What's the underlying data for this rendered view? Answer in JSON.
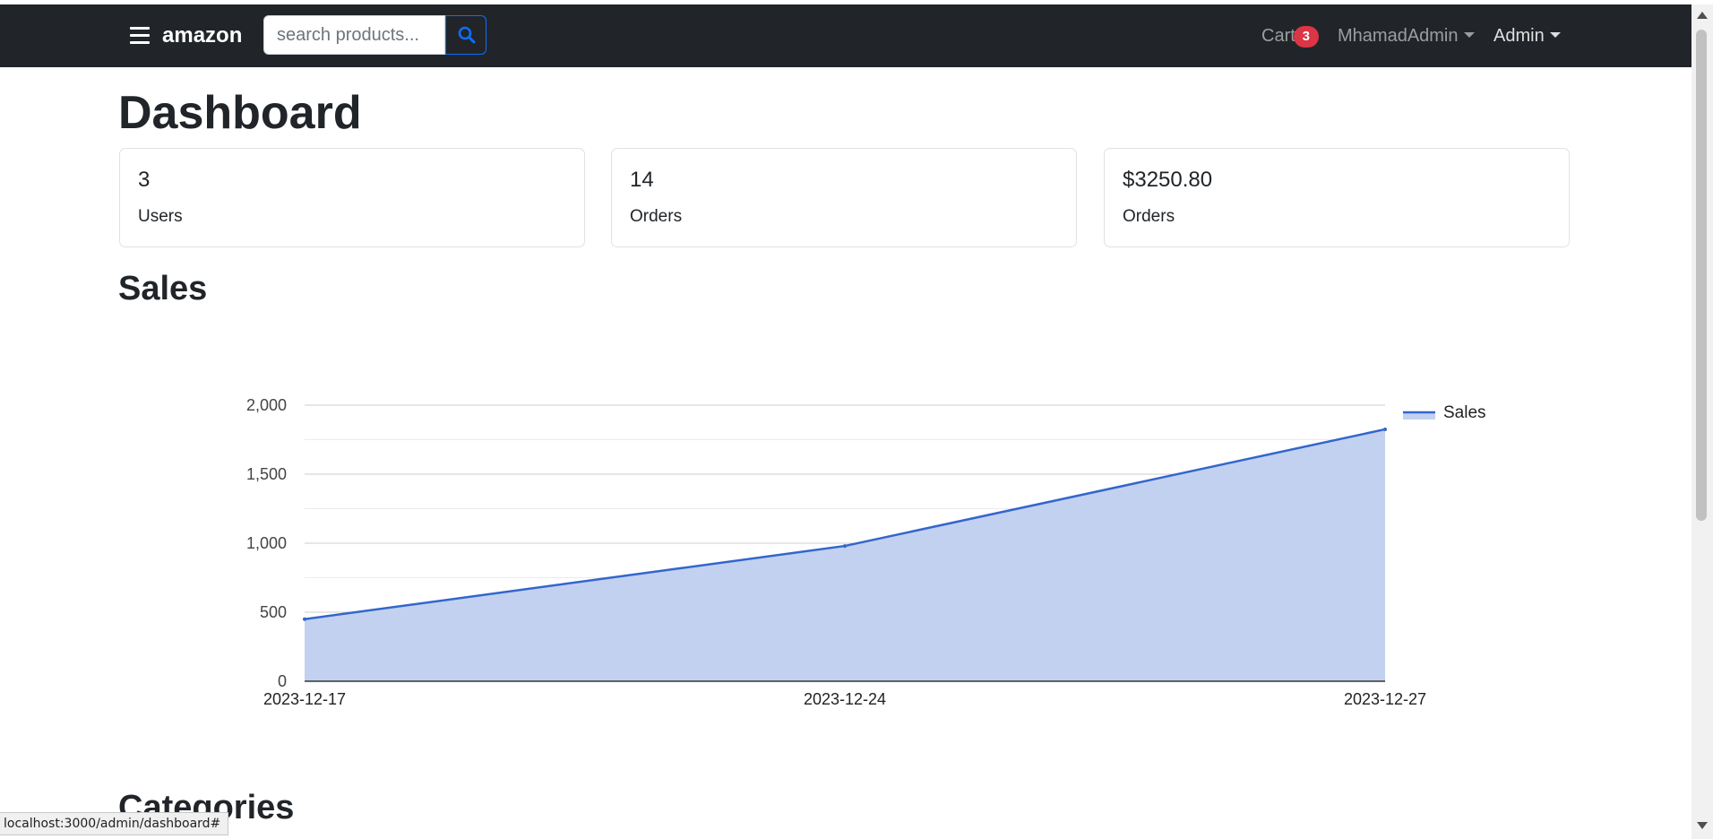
{
  "navbar": {
    "brand": "amazon",
    "search_placeholder": "search products...",
    "cart_label": "Cart",
    "cart_count": "3",
    "user_menu_label": "MhamadAdmin",
    "admin_menu_label": "Admin"
  },
  "page": {
    "title": "Dashboard",
    "sales_heading": "Sales",
    "categories_heading": "Categories"
  },
  "stats": [
    {
      "value": "3",
      "label": "Users"
    },
    {
      "value": "14",
      "label": "Orders"
    },
    {
      "value": "$3250.80",
      "label": "Orders"
    }
  ],
  "chart_data": {
    "type": "area",
    "x": [
      "2023-12-17",
      "2023-12-24",
      "2023-12-27"
    ],
    "series": [
      {
        "name": "Sales",
        "values": [
          450,
          980,
          1825
        ]
      }
    ],
    "yticks": [
      "0",
      "500",
      "1,000",
      "1,500",
      "2,000"
    ],
    "ylim": [
      0,
      2000
    ],
    "grid": true,
    "legend_position": "right",
    "colors": {
      "line": "#3366cc",
      "fill": "#c2d1f0"
    }
  },
  "status_bar": {
    "url": "localhost:3000/admin/dashboard#"
  }
}
